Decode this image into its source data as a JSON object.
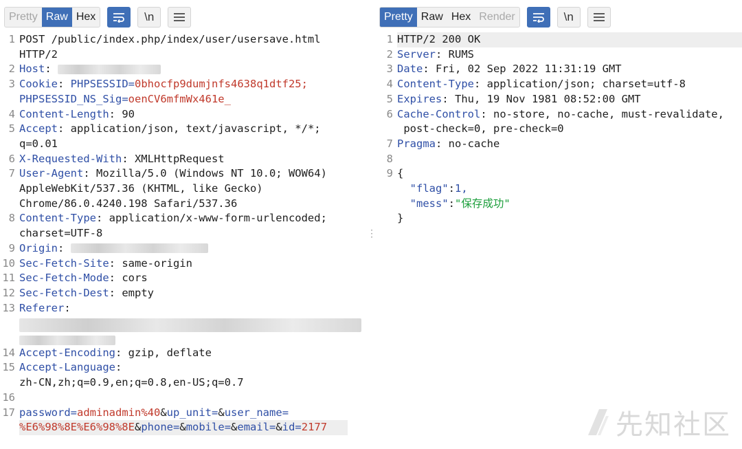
{
  "request": {
    "tabs": [
      {
        "label": "Pretty",
        "state": "disabled"
      },
      {
        "label": "Raw",
        "state": "active"
      },
      {
        "label": "Hex",
        "state": "normal"
      }
    ],
    "newline_label": "\\n",
    "lines": [
      {
        "num": "1",
        "text": "POST /public/index.php/index/user/usersave.html"
      },
      {
        "num": "",
        "text": "HTTP/2"
      },
      {
        "num": "2",
        "key": "Host",
        "rest": ": "
      },
      {
        "num": "3",
        "key": "Cookie",
        "rest": ": ",
        "cookie1_name": "PHPSESSID",
        "cookie1_value": "0bhocfp9dumjnfs4638q1dtf25;"
      },
      {
        "num": "",
        "cookie2_name": "PHPSESSID_NS_Sig",
        "cookie2_value": "oenCV6mfmWx461e_"
      },
      {
        "num": "4",
        "key": "Content-Length",
        "rest": ": 90"
      },
      {
        "num": "5",
        "key": "Accept",
        "rest": ": application/json, text/javascript, */*;"
      },
      {
        "num": "",
        "text": "q=0.01"
      },
      {
        "num": "6",
        "key": "X-Requested-With",
        "rest": ": XMLHttpRequest"
      },
      {
        "num": "7",
        "key": "User-Agent",
        "rest": ": Mozilla/5.0 (Windows NT 10.0; WOW64)"
      },
      {
        "num": "",
        "text": "AppleWebKit/537.36 (KHTML, like Gecko)"
      },
      {
        "num": "",
        "text": "Chrome/86.0.4240.198 Safari/537.36"
      },
      {
        "num": "8",
        "key": "Content-Type",
        "rest": ": application/x-www-form-urlencoded;"
      },
      {
        "num": "",
        "text": "charset=UTF-8"
      },
      {
        "num": "9",
        "key": "Origin",
        "rest": ": "
      },
      {
        "num": "10",
        "key": "Sec-Fetch-Site",
        "rest": ": same-origin"
      },
      {
        "num": "11",
        "key": "Sec-Fetch-Mode",
        "rest": ": cors"
      },
      {
        "num": "12",
        "key": "Sec-Fetch-Dest",
        "rest": ": empty"
      },
      {
        "num": "13",
        "key": "Referer",
        "rest": ":"
      },
      {
        "num": "14",
        "key": "Accept-Encoding",
        "rest": ": gzip, deflate"
      },
      {
        "num": "15",
        "key": "Accept-Language",
        "rest": ":"
      },
      {
        "num": "",
        "text": "zh-CN,zh;q=0.9,en;q=0.8,en-US;q=0.7"
      },
      {
        "num": "16",
        "text": ""
      },
      {
        "num": "17"
      }
    ],
    "body_params_line1": [
      {
        "k": "password",
        "v": "adminadmin%40"
      },
      {
        "k": "up_unit",
        "v": ""
      },
      {
        "k": "user_name",
        "v": ""
      }
    ],
    "body_params_line2": [
      {
        "v": "%E6%98%8E%E6%98%8E"
      },
      {
        "k": "phone",
        "v": ""
      },
      {
        "k": "mobile",
        "v": ""
      },
      {
        "k": "email",
        "v": ""
      },
      {
        "k": "id",
        "v": "2177"
      }
    ]
  },
  "response": {
    "tabs": [
      {
        "label": "Pretty",
        "state": "active"
      },
      {
        "label": "Raw",
        "state": "normal"
      },
      {
        "label": "Hex",
        "state": "normal"
      },
      {
        "label": "Render",
        "state": "faded"
      }
    ],
    "newline_label": "\\n",
    "lines": [
      {
        "num": "1",
        "text": "HTTP/2 200 OK"
      },
      {
        "num": "2",
        "key": "Server",
        "rest": ": RUMS"
      },
      {
        "num": "3",
        "key": "Date",
        "rest": ": Fri, 02 Sep 2022 11:31:19 GMT"
      },
      {
        "num": "4",
        "key": "Content-Type",
        "rest": ": application/json; charset=utf-8"
      },
      {
        "num": "5",
        "key": "Expires",
        "rest": ": Thu, 19 Nov 1981 08:52:00 GMT"
      },
      {
        "num": "6",
        "key": "Cache-Control",
        "rest": ": no-store, no-cache, must-revalidate,"
      },
      {
        "num": "",
        "text": " post-check=0, pre-check=0"
      },
      {
        "num": "7",
        "key": "Pragma",
        "rest": ": no-cache"
      },
      {
        "num": "8",
        "text": ""
      },
      {
        "num": "9",
        "text": "{"
      }
    ],
    "json": [
      {
        "key": "\"flag\"",
        "sep": ":",
        "val": "1,",
        "val_type": "num"
      },
      {
        "key": "\"mess\"",
        "sep": ":",
        "val": "\"保存成功\"",
        "val_type": "str"
      }
    ],
    "json_close": "}"
  },
  "watermark": "先知社区",
  "colors": {
    "accent": "#3f6fb7",
    "header_key": "#2f4fa6",
    "cookie_value": "#c0392b",
    "json_string": "#1a9e3a"
  }
}
